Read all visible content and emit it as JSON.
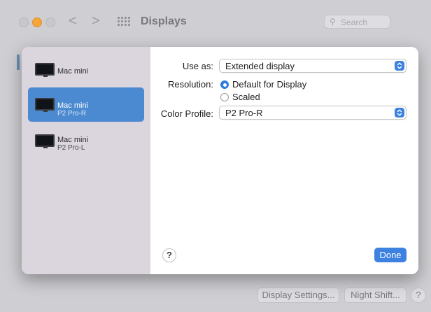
{
  "window": {
    "title": "Displays",
    "search_placeholder": "Search",
    "nav_back": "<",
    "nav_forward": ">",
    "bottom_buttons": {
      "display_settings": "Display Settings...",
      "night_shift": "Night Shift...",
      "help": "?"
    }
  },
  "sheet": {
    "displays": [
      {
        "name": "Mac mini",
        "sub": ""
      },
      {
        "name": "Mac mini",
        "sub": "P2 Pro-R"
      },
      {
        "name": "Mac mini",
        "sub": "P2 Pro-L"
      }
    ],
    "selected_index": 1,
    "use_as_label": "Use as:",
    "use_as_value": "Extended display",
    "resolution_label": "Resolution:",
    "resolution_options": [
      "Default for Display",
      "Scaled"
    ],
    "resolution_selected": "Default for Display",
    "color_profile_label": "Color Profile:",
    "color_profile_value": "P2 Pro-R",
    "help_label": "?",
    "done_label": "Done"
  },
  "colors": {
    "accent": "#3d82e0",
    "sidebar": "#dbd5de",
    "selected": "#4b8ad0"
  }
}
